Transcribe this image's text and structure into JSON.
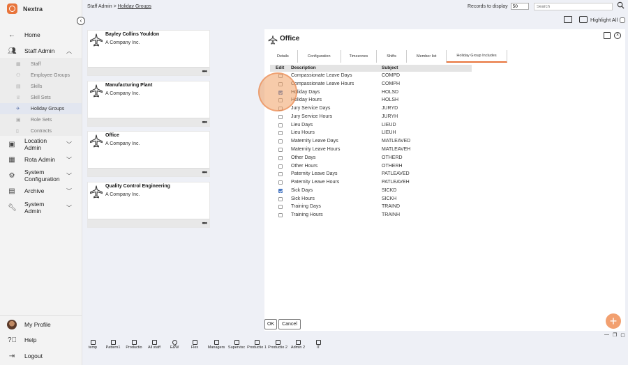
{
  "app": {
    "name": "Nextra"
  },
  "sidebar": {
    "items": [
      {
        "label": "Home",
        "icon": "arrow-left-icon"
      },
      {
        "label": "Staff Admin",
        "icon": "users-icon",
        "expanded": true,
        "children": [
          {
            "label": "Staff",
            "icon": "grid-icon"
          },
          {
            "label": "Employee Groups",
            "icon": "group-icon"
          },
          {
            "label": "Skills",
            "icon": "skills-icon"
          },
          {
            "label": "Skill Sets",
            "icon": "trophy-icon"
          },
          {
            "label": "Holiday Groups",
            "icon": "plane-icon",
            "active": true
          },
          {
            "label": "Role Sets",
            "icon": "roles-icon"
          },
          {
            "label": "Contracts",
            "icon": "document-icon"
          }
        ]
      },
      {
        "label": "Location Admin",
        "icon": "building-icon"
      },
      {
        "label": "Rota Admin",
        "icon": "calendar-icon"
      },
      {
        "label": "System Configuration",
        "icon": "gear-icon"
      },
      {
        "label": "Archive",
        "icon": "archive-icon"
      },
      {
        "label": "System Admin",
        "icon": "wrench-icon"
      }
    ],
    "footer": [
      {
        "label": "My Profile",
        "icon": "avatar"
      },
      {
        "label": "Help",
        "icon": "help-icon"
      },
      {
        "label": "Logout",
        "icon": "logout-icon"
      }
    ]
  },
  "header": {
    "breadcrumb_root": "Staff Admin",
    "breadcrumb_sep": ">",
    "breadcrumb_current": "Holiday Groups",
    "records_label": "Records to display",
    "records_value": "50",
    "search_placeholder": "Search",
    "highlight_label": "Highlight All"
  },
  "cards": [
    {
      "title": "Bayley Collins Youldon",
      "subtitle": "A Company Inc."
    },
    {
      "title": "Manufacturing Plant",
      "subtitle": "A Company Inc."
    },
    {
      "title": "Office",
      "subtitle": "A Company Inc."
    },
    {
      "title": "Quality Control Engineering",
      "subtitle": "A Company Inc."
    }
  ],
  "card_menu": "•••",
  "detail": {
    "title": "Office",
    "tabs": [
      "Details",
      "Configuration",
      "Timezones",
      "Shifts",
      "Member list",
      "Holiday Group Includes"
    ],
    "active_tab": "Holiday Group Includes",
    "columns": {
      "edit": "Edit",
      "description": "Description",
      "subject": "Subject"
    },
    "rows": [
      {
        "description": "Compassionate Leave Days",
        "subject": "COMPD",
        "checked": false
      },
      {
        "description": "Compassionate Leave Hours",
        "subject": "COMPH",
        "checked": false
      },
      {
        "description": "Holiday Days",
        "subject": "HOLSD",
        "checked": true
      },
      {
        "description": "Holiday Hours",
        "subject": "HOLSH",
        "checked": false
      },
      {
        "description": "Jury Service Days",
        "subject": "JURYD",
        "checked": false
      },
      {
        "description": "Jury Service Hours",
        "subject": "JURYH",
        "checked": false
      },
      {
        "description": "Lieu Days",
        "subject": "LIEUD",
        "checked": false
      },
      {
        "description": "Lieu Hours",
        "subject": "LIEUH",
        "checked": false
      },
      {
        "description": "Maternity Leave Days",
        "subject": "MATLEAVED",
        "checked": false
      },
      {
        "description": "Maternity Leave Hours",
        "subject": "MATLEAVEH",
        "checked": false
      },
      {
        "description": "Other Days",
        "subject": "OTHERD",
        "checked": false
      },
      {
        "description": "Other Hours",
        "subject": "OTHERH",
        "checked": false
      },
      {
        "description": "Paternity Leave Days",
        "subject": "PATLEAVED",
        "checked": false
      },
      {
        "description": "Paternity Leave Hours",
        "subject": "PATLEAVEH",
        "checked": false
      },
      {
        "description": "Sick Days",
        "subject": "SICKD",
        "checked": true
      },
      {
        "description": "Sick Hours",
        "subject": "SICKH",
        "checked": false
      },
      {
        "description": "Training Days",
        "subject": "TRAIND",
        "checked": false
      },
      {
        "description": "Training Hours",
        "subject": "TRAINH",
        "checked": false
      }
    ],
    "ok_label": "OK",
    "cancel_label": "Cancel"
  },
  "fab_label": "+",
  "bottom_tabs": [
    "temp",
    "Pattern1",
    "Productio",
    "All staff",
    "E&W",
    "Flex",
    "Managers",
    "Supervisc",
    "Productio 1",
    "Productio 2",
    "Admin 2",
    "IT"
  ],
  "colors": {
    "accent": "#e8743b",
    "checkbox_on": "#4a78c2",
    "active_nav_bg": "#e2e6f0"
  }
}
